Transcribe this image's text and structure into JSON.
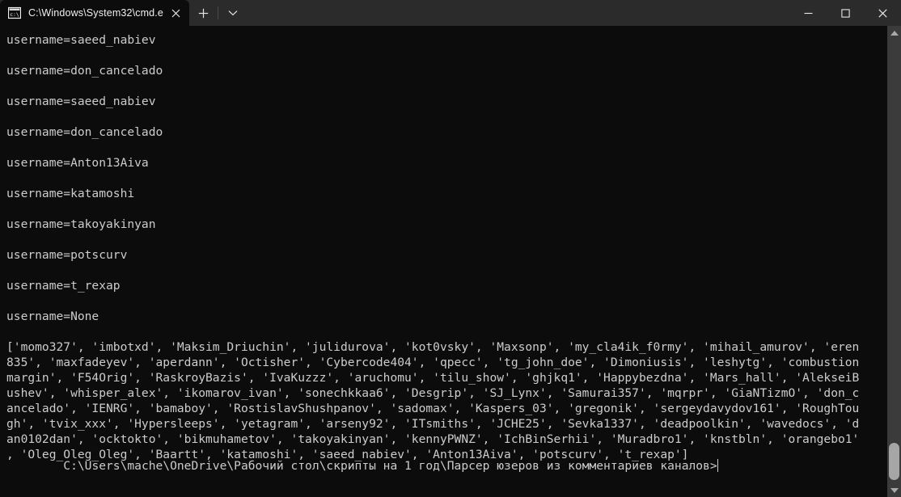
{
  "window": {
    "title": "C:\\Windows\\System32\\cmd.e",
    "background_color": "#0c0c0c",
    "titlebar_color": "#2b2b2b",
    "text_color": "#cccccc"
  },
  "tabbar": {
    "tab_title": "C:\\Windows\\System32\\cmd.e",
    "tab_icon": "cmd-icon",
    "close_label": "✕",
    "new_tab_label": "+",
    "dropdown_label": "∨"
  },
  "window_controls": {
    "minimize": "—",
    "maximize": "☐",
    "close": "✕"
  },
  "terminal": {
    "lines": [
      "username=saeed_nabiev",
      "",
      "username=don_cancelado",
      "",
      "username=saeed_nabiev",
      "",
      "username=don_cancelado",
      "",
      "username=Anton13Aiva",
      "",
      "username=katamoshi",
      "",
      "username=takoyakinyan",
      "",
      "username=potscurv",
      "",
      "username=t_rexap",
      "",
      "username=None",
      "",
      "['momo327', 'imbotxd', 'Maksim_Driuchin', 'julidurova', 'kot0vsky', 'Maxsonp', 'my_cla4ik_f0rmy', 'mihail_amurov', 'eren",
      "835', 'maxfadeyev', 'aperdann', 'Octisher', 'Cybercode404', 'qpecc', 'tg_john_doe', 'Dimoniusis', 'leshytg', 'combustion",
      "margin', 'F54Orig', 'RaskroyBazis', 'IvaKuzzz', 'aruchomu', 'tilu_show', 'ghjkq1', 'Happybezdna', 'Mars_hall', 'AlekseiB",
      "ushev', 'whisper_alex', 'ikomarov_ivan', 'sonechkkaa6', 'Desgrip', 'SJ_Lynx', 'Samurai357', 'mqrpr', 'GiaNTizmO', 'don_c",
      "ancelado', 'IENRG', 'bamaboy', 'RostislavShushpanov', 'sadomax', 'Kaspers_03', 'gregonik', 'sergeydavydov161', 'RoughTou",
      "gh', 'tvix_xxx', 'Hypersleeps', 'yetagram', 'arseny92', 'ITsmiths', 'JCHE25', 'Sevka1337', 'deadpoolkin', 'wavedocs', 'd",
      "an0102dan', 'ocktokto', 'bikmuhametov', 'takoyakinyan', 'kennyPWNZ', 'IchBinSerhii', 'Muradbro1', 'knstbln', 'orangebo1'",
      ", 'Oleg_Oleg_Oleg', 'Baartt', 'katamoshi', 'saeed_nabiev', 'Anton13Aiva', 'potscurv', 't_rexap']"
    ],
    "prompt": "C:\\Users\\mache\\OneDrive\\Рабочий стол\\скрипты на 1 год\\Парсер юзеров из комментариев каналов>"
  },
  "scrollbar": {
    "up_arrow": "▲",
    "down_arrow": "▼"
  }
}
